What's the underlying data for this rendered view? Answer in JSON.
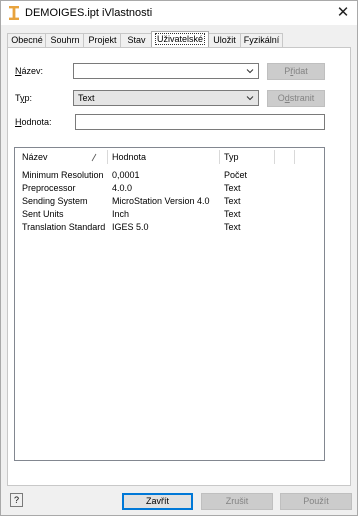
{
  "window": {
    "title": "DEMOIGES.ipt iVlastnosti",
    "close_glyph": "✕",
    "icon": "inventor-part-icon"
  },
  "tabs": [
    {
      "label": "Obecné",
      "active": false
    },
    {
      "label": "Souhrn",
      "active": false
    },
    {
      "label": "Projekt",
      "active": false
    },
    {
      "label": "Stav",
      "active": false
    },
    {
      "label": "Uživatelské",
      "active": true
    },
    {
      "label": "Uložit",
      "active": false
    },
    {
      "label": "Fyzikální",
      "active": false
    }
  ],
  "form": {
    "name_label_key": "N",
    "name_label_rest": "ázev:",
    "name_value": "",
    "type_label_pre": "T",
    "type_label_key": "y",
    "type_label_rest": "p:",
    "type_value": "Text",
    "value_label_key": "H",
    "value_label_rest": "odnota:",
    "value_value": "",
    "add_button_pre": "P",
    "add_button_key": "ř",
    "add_button_rest": "idat",
    "remove_button_pre": "O",
    "remove_button_key": "d",
    "remove_button_rest": "stranit"
  },
  "properties_table": {
    "columns": [
      "Název",
      "Hodnota",
      "Typ"
    ],
    "rows": [
      {
        "name": "Minimum Resolution",
        "value": "0,0001",
        "type": "Počet"
      },
      {
        "name": "Preprocessor",
        "value": "4.0.0",
        "type": "Text"
      },
      {
        "name": "Sending System",
        "value": "MicroStation Version 4.0",
        "type": "Text"
      },
      {
        "name": "Sent Units",
        "value": "Inch",
        "type": "Text"
      },
      {
        "name": "Translation Standard",
        "value": "IGES 5.0",
        "type": "Text"
      }
    ]
  },
  "footer": {
    "help_label": "?",
    "close_label": "Zavřít",
    "cancel_label": "Zrušit",
    "apply_label": "Použít"
  },
  "colors": {
    "accent": "#0078d7",
    "disabled_bg": "#cccccc",
    "disabled_text": "#838383",
    "icon_orange": "#e8a33d"
  }
}
